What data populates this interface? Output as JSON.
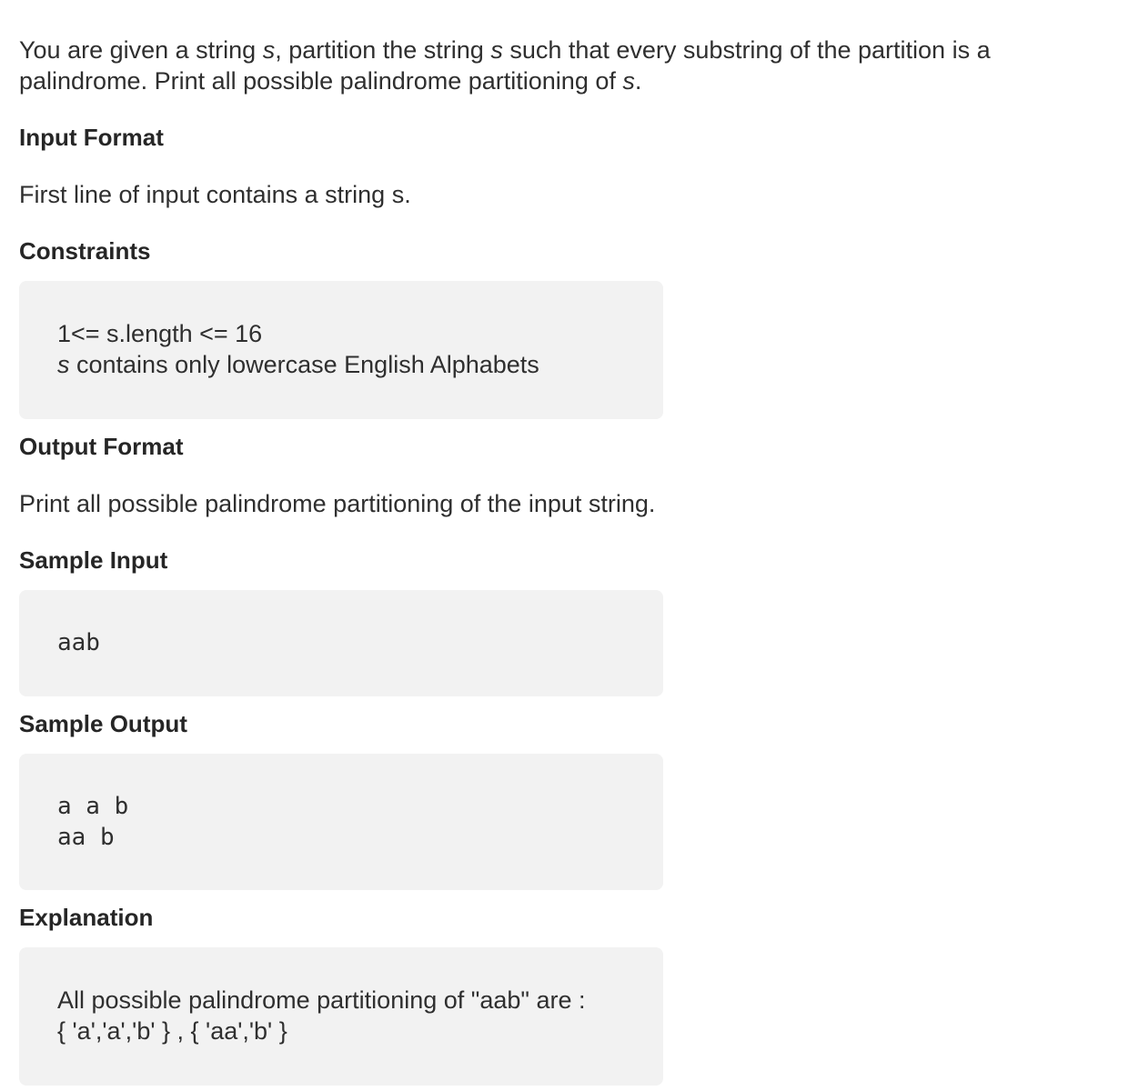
{
  "description": {
    "line1_a": "You are given a string ",
    "line1_var1": "s",
    "line1_b": ", partition the string ",
    "line1_var2": "s",
    "line1_c": " such that every substring of the partition is a",
    "line2_a": "palindrome. Print all possible palindrome partitioning of ",
    "line2_var": "s",
    "line2_b": "."
  },
  "input_format": {
    "heading": "Input Format",
    "text": "First line of input contains a string s."
  },
  "constraints": {
    "heading": "Constraints",
    "line1": "1<= s.length <= 16",
    "line2_var": "s",
    "line2_rest": " contains only lowercase English Alphabets"
  },
  "output_format": {
    "heading": "Output Format",
    "text": "Print all possible palindrome partitioning of the input string."
  },
  "sample_input": {
    "heading": "Sample Input",
    "lines": [
      "aab"
    ]
  },
  "sample_output": {
    "heading": "Sample Output",
    "lines": [
      "a a b",
      "aa b"
    ]
  },
  "explanation": {
    "heading": "Explanation",
    "line1": "All possible palindrome partitioning of \"aab\" are :",
    "line2": "{ 'a','a','b' } , { 'aa','b' }"
  }
}
